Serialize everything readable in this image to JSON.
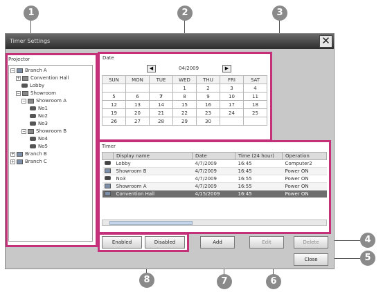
{
  "window": {
    "title": "Timer Settings",
    "close_glyph": "✕"
  },
  "projector": {
    "title": "Projector",
    "tree": [
      {
        "label": "Branch A",
        "expander": "−",
        "icon": "building-icon"
      },
      {
        "label": "Convention Hall",
        "expander": "+",
        "icon": "room-icon"
      },
      {
        "label": "Lobby",
        "expander": "",
        "icon": "projector-icon"
      },
      {
        "label": "Showroom",
        "expander": "−",
        "icon": "room-icon"
      },
      {
        "label": "Showroom A",
        "expander": "−",
        "icon": "room-icon"
      },
      {
        "label": "No1",
        "expander": "",
        "icon": "projector-icon"
      },
      {
        "label": "No2",
        "expander": "",
        "icon": "projector-icon"
      },
      {
        "label": "No3",
        "expander": "",
        "icon": "projector-icon"
      },
      {
        "label": "Showroom B",
        "expander": "−",
        "icon": "room-icon"
      },
      {
        "label": "No4",
        "expander": "",
        "icon": "projector-icon"
      },
      {
        "label": "No5",
        "expander": "",
        "icon": "projector-icon"
      },
      {
        "label": "Branch B",
        "expander": "+",
        "icon": "building-icon"
      },
      {
        "label": "Branch C",
        "expander": "+",
        "icon": "building-icon"
      }
    ]
  },
  "calendar": {
    "title": "Date",
    "month": "04/2009",
    "prev": "◀",
    "next": "▶",
    "weekdays": [
      "SUN",
      "MON",
      "TUE",
      "WED",
      "THU",
      "FRI",
      "SAT"
    ],
    "weeks": [
      [
        "",
        "",
        "",
        "1",
        "2",
        "3",
        "4"
      ],
      [
        "5",
        "6",
        "7",
        "8",
        "9",
        "10",
        "11"
      ],
      [
        "12",
        "13",
        "14",
        "15",
        "16",
        "17",
        "18"
      ],
      [
        "19",
        "20",
        "21",
        "22",
        "23",
        "24",
        "25"
      ],
      [
        "26",
        "27",
        "28",
        "29",
        "30",
        "",
        ""
      ]
    ],
    "today": "7"
  },
  "timer": {
    "title": "Timer",
    "columns": [
      "",
      "Display name",
      "Date",
      "Time (24 hour)",
      "Operation"
    ],
    "rows": [
      {
        "icon": "projector-icon",
        "name": "Lobby",
        "date": "4/7/2009",
        "time": "16:45",
        "op": "Computer2"
      },
      {
        "icon": "room-icon",
        "name": "Showroom B",
        "date": "4/7/2009",
        "time": "16:45",
        "op": "Power ON"
      },
      {
        "icon": "projector-icon",
        "name": "No3",
        "date": "4/7/2009",
        "time": "16:55",
        "op": "Power ON"
      },
      {
        "icon": "room-icon",
        "name": "Showroom A",
        "date": "4/7/2009",
        "time": "16:55",
        "op": "Power ON"
      },
      {
        "icon": "room-icon",
        "name": "Convention Hall",
        "date": "4/15/2009",
        "time": "16:45",
        "op": "Power ON"
      }
    ],
    "selected_row": 4
  },
  "buttons": {
    "enabled": "Enabled",
    "disabled": "Disabled",
    "add": "Add",
    "edit": "Edit",
    "delete": "Delete",
    "close": "Close"
  },
  "callouts": [
    "1",
    "2",
    "3",
    "4",
    "5",
    "6",
    "7",
    "8"
  ],
  "colors": {
    "highlight": "#c4307a",
    "callout": "#8a8a8a"
  }
}
